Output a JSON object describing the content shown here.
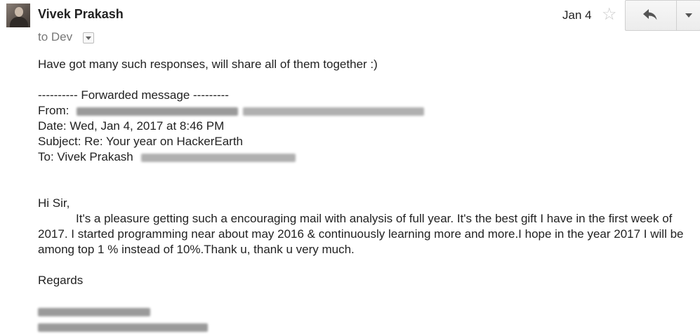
{
  "header": {
    "sender_name": "Vivek Prakash",
    "recipient": "to Dev",
    "date": "Jan 4"
  },
  "icons": {
    "avatar": "avatar",
    "recipient_dropdown": "chevron-down-icon",
    "star": "star-icon",
    "reply": "reply-icon",
    "more": "chevron-down-icon"
  },
  "body": {
    "intro": "Have got many such responses, will share all of them together :)",
    "forward_header": "---------- Forwarded message ---------",
    "from_label": "From:",
    "date_line": "Date: Wed, Jan 4, 2017 at 8:46 PM",
    "subject_line": "Subject: Re: Your year on HackerEarth",
    "to_label": "To: Vivek Prakash",
    "greeting": "Hi Sir,",
    "paragraph": "It's a pleasure getting such a encouraging mail with analysis of full year. It's the best gift I have in the first week of 2017. I started programming near about may 2016 & continuously learning more and more.I hope in the year 2017 I will be among top 1 % instead of 10%.Thank u, thank u very much.",
    "signoff": "Regards"
  }
}
